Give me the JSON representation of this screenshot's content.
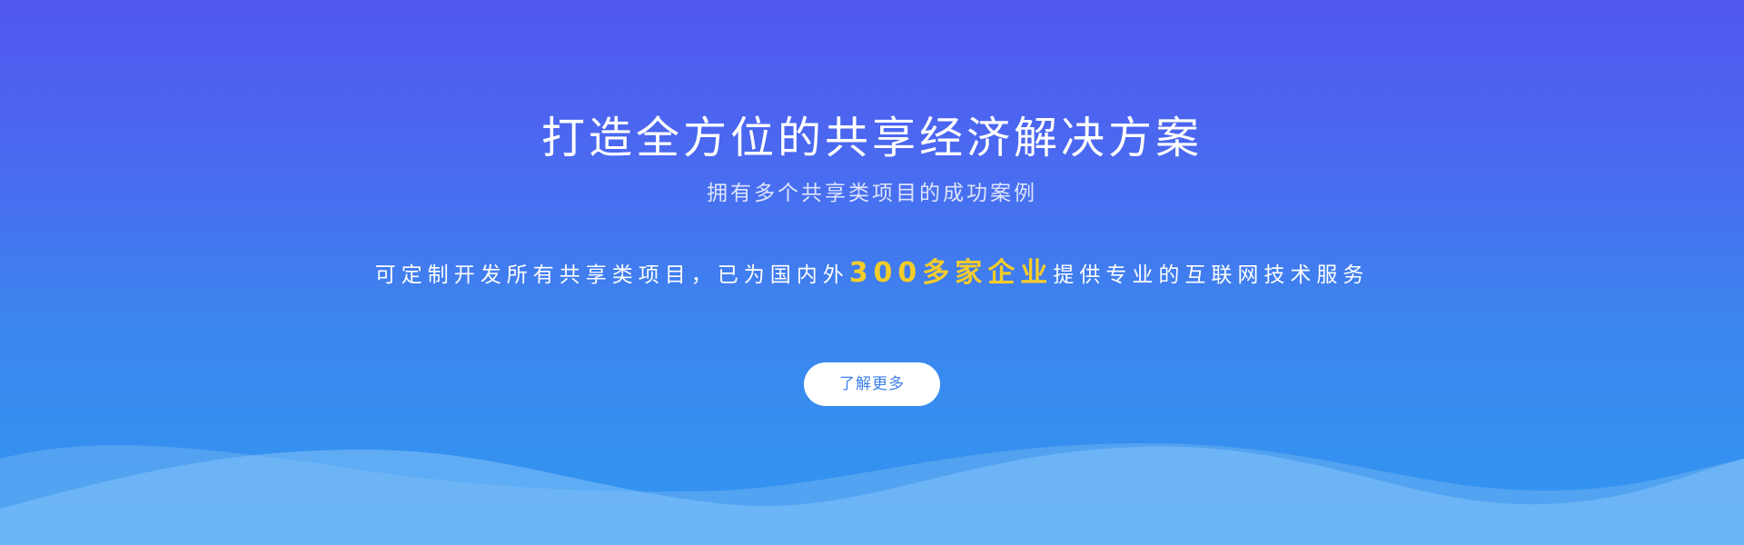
{
  "hero": {
    "title": "打造全方位的共享经济解决方案",
    "subtitle": "拥有多个共享类项目的成功案例",
    "tagline": {
      "before": "可定制开发所有共享类项目，已为国内外",
      "highlight": "300多家企业",
      "after": "提供专业的互联网技术服务"
    },
    "cta_label": "了解更多"
  },
  "colors": {
    "background_top": "#5157ef",
    "background_bottom": "#3197f0",
    "highlight": "#f5cc2a",
    "button_text": "#3c7fe8",
    "button_bg": "#ffffff"
  }
}
